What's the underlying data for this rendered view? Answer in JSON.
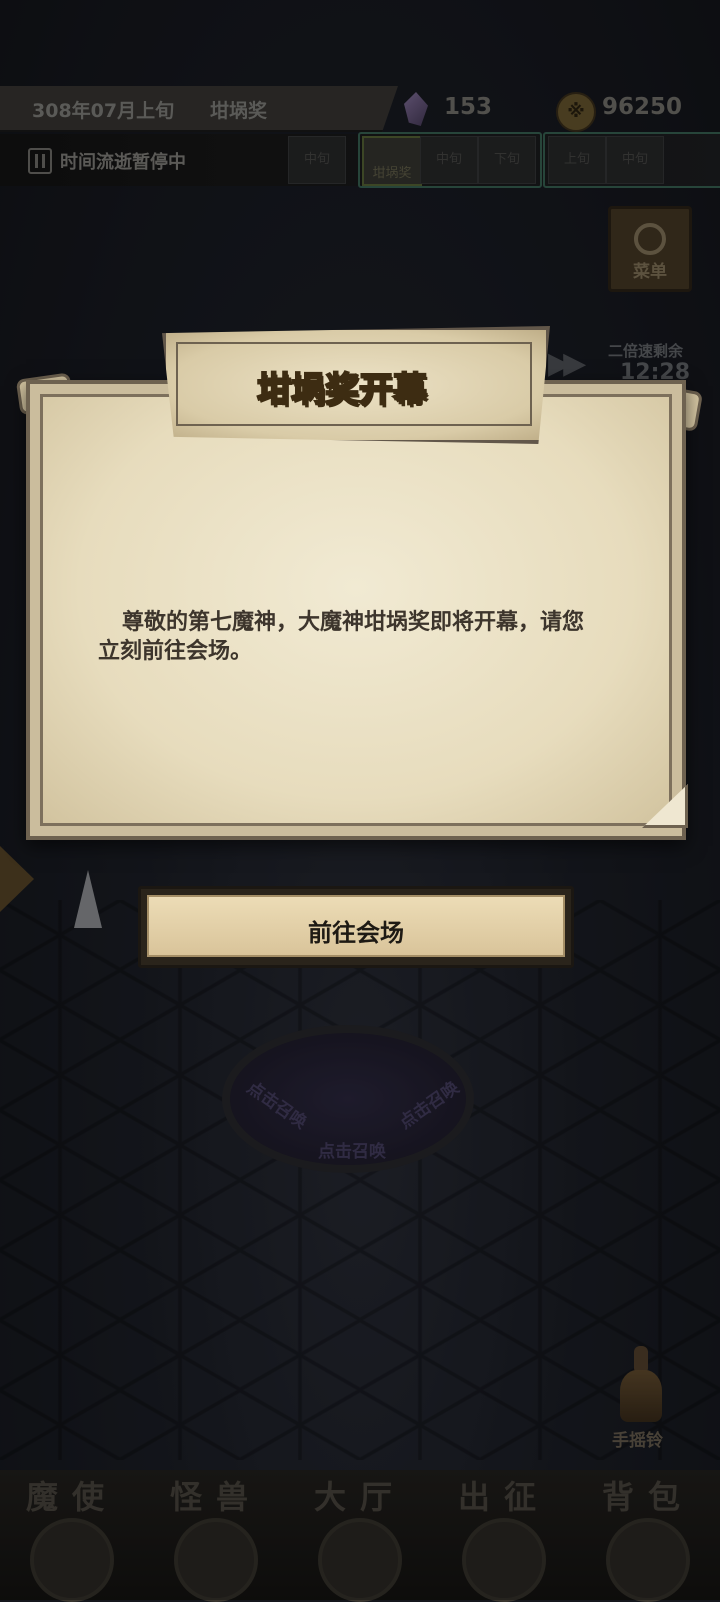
{
  "header": {
    "date": "308年07月上旬",
    "event": "坩埚奖",
    "crystals": "153",
    "coins": "96250",
    "coin_symbol": "※"
  },
  "time_status": {
    "text": "时间流逝暂停中",
    "slots": [
      "中旬",
      "",
      "坩埚奖",
      "中旬",
      "下旬",
      "上旬",
      "中旬",
      ""
    ]
  },
  "menu_button": {
    "label": "菜单",
    "icon": "g-icon"
  },
  "speed": {
    "label": "二倍速剩余",
    "time": "12:28",
    "icon": "fast-forward-icon"
  },
  "dialog": {
    "title": "坩埚奖开幕",
    "message": "尊敬的第七魔神，大魔神坩埚奖即将开幕，请您立刻前往会场。",
    "button": "前往会场"
  },
  "summon_circle": {
    "texts": [
      "点击召唤",
      "点击召唤",
      "点击召唤"
    ]
  },
  "bell": {
    "label": "手摇铃",
    "icon": "bell-icon"
  },
  "nav": [
    {
      "label": "魔使",
      "icon": "skull-icon"
    },
    {
      "label": "怪兽",
      "icon": "monster-icon"
    },
    {
      "label": "大厅",
      "icon": "hall-icon"
    },
    {
      "label": "出征",
      "icon": "battle-icon"
    },
    {
      "label": "背包",
      "icon": "bag-icon"
    }
  ],
  "colors": {
    "title_gold": "#e8c24b",
    "paper": "#e7dcbd",
    "text_dark": "#3d352c"
  }
}
